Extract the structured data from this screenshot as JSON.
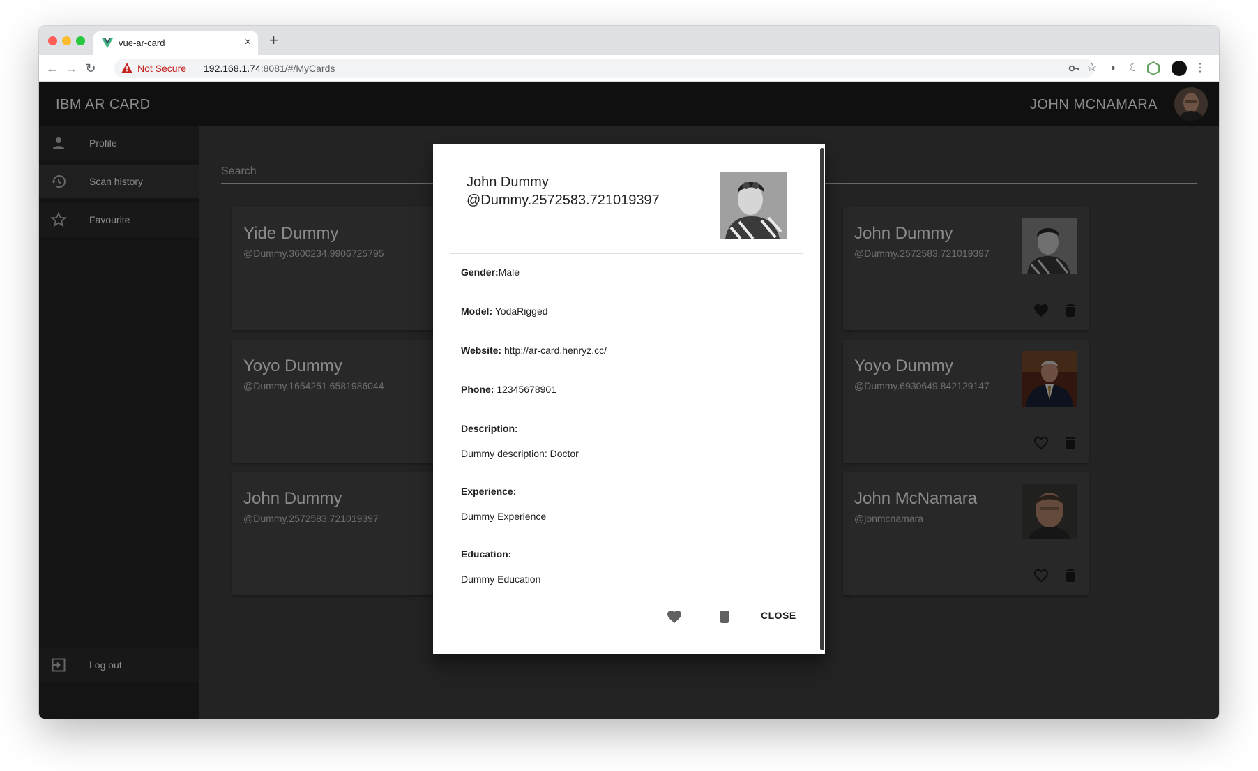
{
  "browser": {
    "tab_title": "vue-ar-card",
    "new_tab": "+",
    "tab_close": "×",
    "security_label": "Not Secure",
    "url_host": "192.168.1.74",
    "url_rest": ":8081/#/MyCards"
  },
  "app": {
    "brand": "IBM AR CARD",
    "user_name": "JOHN MCNAMARA"
  },
  "sidebar": {
    "items": [
      {
        "label": "Profile",
        "icon": "person-icon"
      },
      {
        "label": "Scan history",
        "icon": "history-icon"
      },
      {
        "label": "Favourite",
        "icon": "star-icon"
      }
    ],
    "logout_label": "Log out"
  },
  "search": {
    "placeholder": "Search"
  },
  "cards": [
    {
      "name": "Yide Dummy",
      "handle": "@Dummy.3600234.9906725795"
    },
    {
      "name": "Yoyo Dummy",
      "handle": "@Dummy.1654251.6581986044"
    },
    {
      "name": "John Dummy",
      "handle": "@Dummy.2572583.721019397"
    },
    {
      "name": "John Dummy",
      "handle": "@Dummy.2572583.721019397",
      "favourite": true
    },
    {
      "name": "Yoyo Dummy",
      "handle": "@Dummy.6930649.842129147",
      "favourite": false
    },
    {
      "name": "John McNamara",
      "handle": "@jonmcnamara",
      "favourite": false
    }
  ],
  "dialog": {
    "name": "John Dummy",
    "handle": "@Dummy.2572583.721019397",
    "gender_label": "Gender:",
    "gender": "Male",
    "model_label": "Model:",
    "model": " YodaRigged",
    "website_label": "Website:",
    "website": " http://ar-card.henryz.cc/",
    "phone_label": "Phone:",
    "phone": " 12345678901",
    "description_label": "Description:",
    "description": "Dummy description: Doctor",
    "experience_label": "Experience:",
    "experience": "Dummy Experience",
    "education_label": "Education:",
    "education": "Dummy Education",
    "close_label": "CLOSE"
  },
  "colors": {
    "appbar": "#1e1e1e",
    "drawer": "#252526",
    "content": "#424242",
    "card": "#4a4a4a",
    "not_secure": "#c5221f"
  }
}
